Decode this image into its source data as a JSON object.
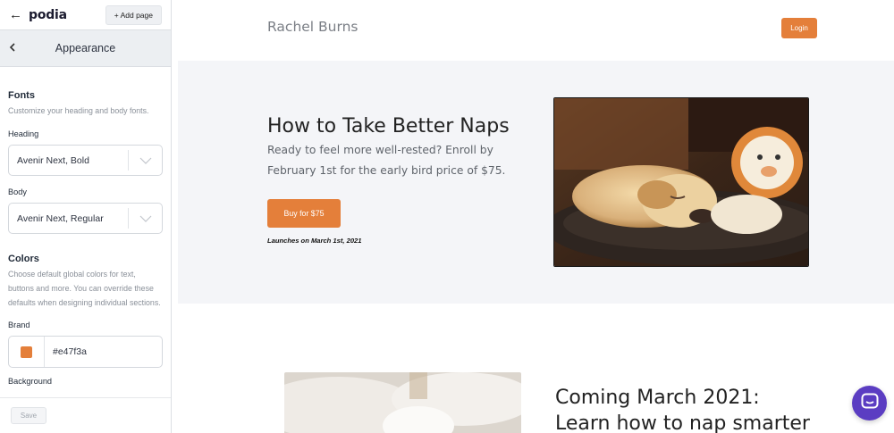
{
  "topbar": {
    "logo": "podia",
    "add_page": "+ Add page"
  },
  "subheader": {
    "title": "Appearance"
  },
  "fonts": {
    "title": "Fonts",
    "desc": "Customize your heading and body fonts.",
    "heading_label": "Heading",
    "heading_value": "Avenir Next, Bold",
    "body_label": "Body",
    "body_value": "Avenir Next, Regular"
  },
  "colors": {
    "title": "Colors",
    "desc": "Choose default global colors for text, buttons and more. You can override these defaults when designing individual sections.",
    "brand_label": "Brand",
    "brand_value": "#e47f3a",
    "background_label": "Background"
  },
  "footer": {
    "save_label": "Save"
  },
  "preview": {
    "site_name": "Rachel Burns",
    "login_label": "Login",
    "hero": {
      "title": "How to Take Better Naps",
      "text": "Ready to feel more well-rested? Enroll by February 1st for the early bird price of $75.",
      "buy_label": "Buy for $75",
      "launch_note": "Launches on March 1st, 2021"
    },
    "section2": {
      "title_line1": "Coming March 2021:",
      "title_line2": "Learn how to nap smarter"
    }
  },
  "theme": {
    "accent": "#e47f3a",
    "chat": "#5b3dc2"
  },
  "icons": [
    "back-arrow-icon",
    "chevron-left-icon",
    "chevron-down-icon",
    "chat-icon"
  ]
}
